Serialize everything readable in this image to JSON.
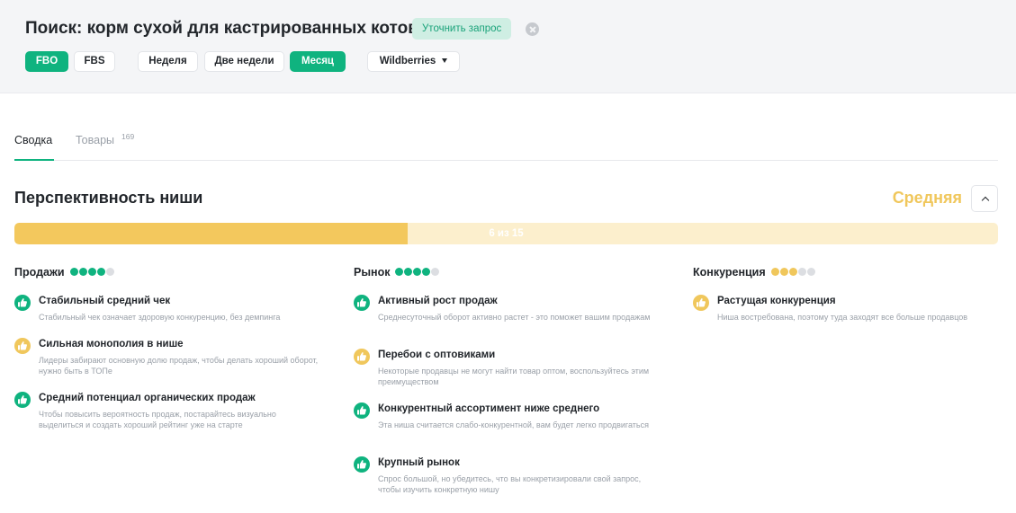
{
  "header": {
    "title": "Поиск: корм сухой для кастрированных котов",
    "refine_label": "Уточнить запрос",
    "fulfillment": [
      {
        "label": "FBO",
        "active": true
      },
      {
        "label": "FBS",
        "active": false
      }
    ],
    "periods": [
      {
        "label": "Неделя",
        "active": false
      },
      {
        "label": "Две недели",
        "active": false
      },
      {
        "label": "Месяц",
        "active": true
      }
    ],
    "marketplace": {
      "selected": "Wildberries"
    }
  },
  "tabs": [
    {
      "label": "Сводка",
      "active": true
    },
    {
      "label": "Товары",
      "count": "169",
      "active": false
    }
  ],
  "niche": {
    "title": "Перспективность ниши",
    "rating": "Средняя",
    "score_text": "6 из 15",
    "score": 6,
    "score_max": 15
  },
  "columns": [
    {
      "title": "Продажи",
      "dots_filled": 4,
      "dots_total": 5,
      "dot_color": "green",
      "items": [
        {
          "title": "Стабильный средний чек",
          "desc": "Стабильный чек означает здоровую конкуренцию, без демпинга",
          "status": "green"
        },
        {
          "title": "Сильная монополия в нише",
          "desc": "Лидеры забирают основную долю продаж, чтобы делать хороший оборот, нужно быть в ТОПе",
          "status": "yellow"
        },
        {
          "title": "Средний потенциал органических продаж",
          "desc": "Чтобы повысить вероятность продаж, постарайтесь визуально выделиться и создать хороший рейтинг уже на старте",
          "status": "green"
        }
      ]
    },
    {
      "title": "Рынок",
      "dots_filled": 4,
      "dots_total": 5,
      "dot_color": "green",
      "items": [
        {
          "title": "Активный рост продаж",
          "desc": "Среднесуточный оборот активно растет - это поможет вашим продажам",
          "status": "green"
        },
        {
          "title": "Перебои с оптовиками",
          "desc": "Некоторые продавцы не могут найти товар оптом, воспользуйтесь этим преимуществом",
          "status": "yellow"
        },
        {
          "title": "Конкурентный ассортимент ниже среднего",
          "desc": "Эта ниша считается слабо-конкурентной, вам будет легко продвигаться",
          "status": "green"
        },
        {
          "title": "Крупный рынок",
          "desc": "Спрос большой, но убедитесь, что вы конкретизировали свой запрос, чтобы изучить конкретную нишу",
          "status": "green"
        }
      ]
    },
    {
      "title": "Конкуренция",
      "dots_filled": 3,
      "dots_total": 5,
      "dot_color": "yellow",
      "items": [
        {
          "title": "Растущая конкуренция",
          "desc": "Ниша востребована, поэтому туда заходят все больше продавцов",
          "status": "yellow"
        }
      ]
    }
  ],
  "colors": {
    "accent_green": "#0fb37f",
    "warning_yellow": "#f0c75c",
    "progress_track": "#fcefcd",
    "progress_fill": "#f3c85d"
  }
}
